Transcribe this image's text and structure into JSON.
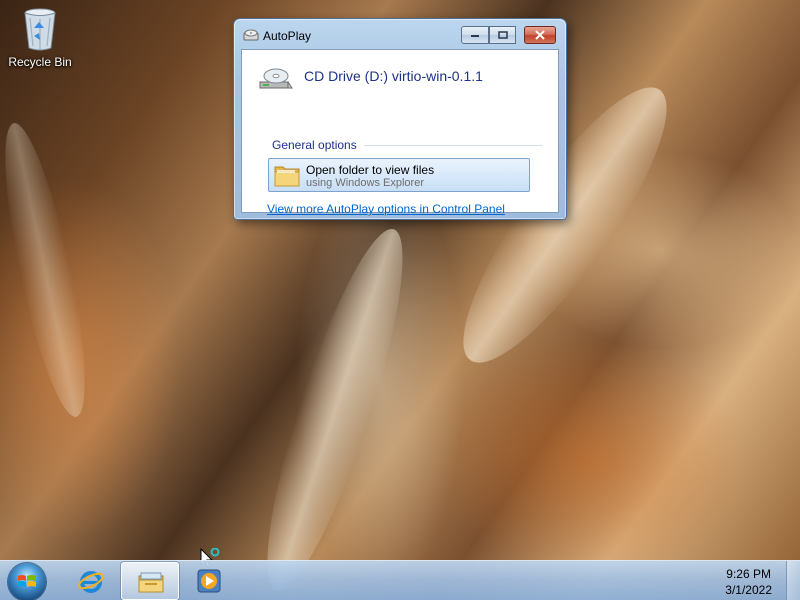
{
  "desktop": {
    "icons": [
      {
        "label": "Recycle Bin",
        "icon": "recycle-bin-icon"
      }
    ]
  },
  "autoplay": {
    "title": "AutoPlay",
    "drive_title": "CD Drive (D:) virtio-win-0.1.1",
    "group_label": "General options",
    "option": {
      "title": "Open folder to view files",
      "subtitle": "using Windows Explorer",
      "icon": "folder-icon"
    },
    "control_panel_link": "View more AutoPlay options in Control Panel"
  },
  "taskbar": {
    "items": [
      {
        "name": "start",
        "icon": "windows-logo-icon"
      },
      {
        "name": "internet-explorer",
        "icon": "internet-explorer-icon"
      },
      {
        "name": "windows-explorer",
        "icon": "folder-library-icon",
        "active": true
      },
      {
        "name": "media-player",
        "icon": "media-player-icon"
      }
    ],
    "clock": {
      "time": "9:26 PM",
      "date": "3/1/2022"
    }
  },
  "colors": {
    "link": "#0066cc",
    "heading": "#1e3287",
    "close_button": "#c0432b"
  }
}
